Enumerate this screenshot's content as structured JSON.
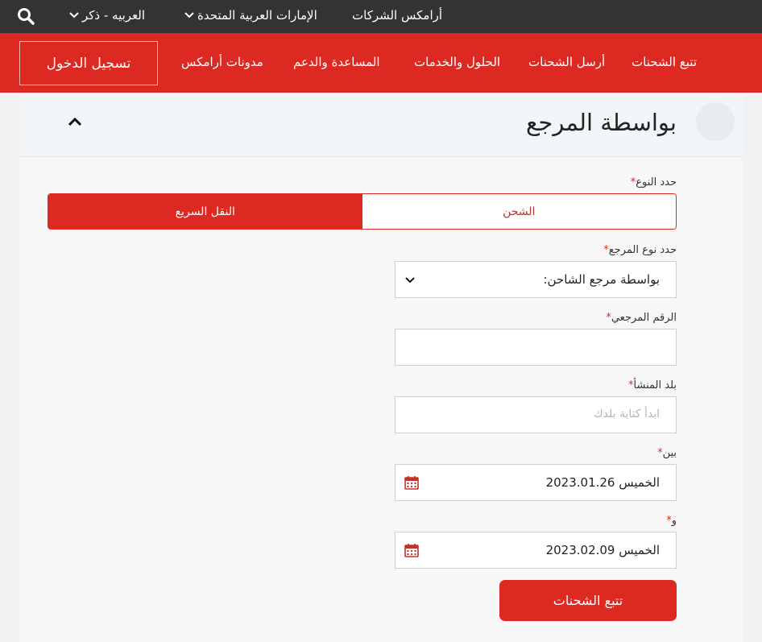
{
  "topbar": {
    "business_label": "أرامكس الشركات",
    "country_label": "الإمارات العربية المتحدة",
    "language_label": "العربيه - ذكر"
  },
  "nav": {
    "track": "تتبع الشحنات",
    "send": "أرسل الشحنات",
    "solutions": "الحلول والخدمات",
    "help": "المساعدة والدعم",
    "blogs": "مدونات أرامكس",
    "login": "تسجيل الدخول"
  },
  "section": {
    "title": "بواسطة المرجع"
  },
  "form": {
    "type_label": "حدد النوع",
    "type_options": {
      "shipment": "الشحن",
      "express": "النقل السريع"
    },
    "selected_type": "express",
    "ref_type_label": "حدد نوع المرجع",
    "ref_type_value": "بواسطة مرجع الشاحن:",
    "ref_number_label": "الرقم المرجعي",
    "ref_number_value": "",
    "origin_label": "بلد المنشأ",
    "origin_placeholder": "ابدأ كتابة بلدك",
    "from_label": "بين",
    "from_date": "الخميس  2023.01.26",
    "to_label": "و",
    "to_date": "الخميس  2023.02.09",
    "required_mark": "*",
    "submit": "تتبع الشحنات"
  },
  "colors": {
    "brand_red": "#dc2a23",
    "topbar": "#333333"
  },
  "icons": {
    "search": "search-icon",
    "chevron": "chevron-down-icon",
    "collapse": "chevron-up-icon",
    "calendar": "calendar-icon"
  }
}
